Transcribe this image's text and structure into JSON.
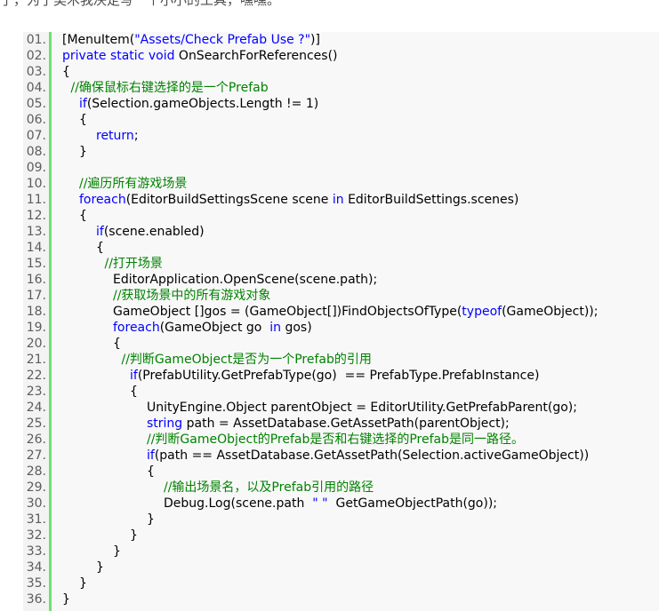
{
  "intro_text": "了，为了美术我决定写一个小小的工具，嘿嘿。",
  "code": {
    "lines": [
      {
        "num": "01.",
        "indent": 0,
        "tokens": [
          {
            "t": "[MenuItem(",
            "c": "plain"
          },
          {
            "t": "\"Assets/Check Prefab Use ?\"",
            "c": "string"
          },
          {
            "t": ")]",
            "c": "plain"
          }
        ]
      },
      {
        "num": "02.",
        "indent": 0,
        "tokens": [
          {
            "t": "private static void",
            "c": "keyword"
          },
          {
            "t": " OnSearchForReferences()",
            "c": "plain"
          }
        ]
      },
      {
        "num": "03.",
        "indent": 0,
        "tokens": [
          {
            "t": "{",
            "c": "plain"
          }
        ]
      },
      {
        "num": "04.",
        "indent": 1,
        "tokens": [
          {
            "t": "//确保鼠标右键选择的是一个Prefab",
            "c": "comment"
          }
        ]
      },
      {
        "num": "05.",
        "indent": 2,
        "tokens": [
          {
            "t": "if",
            "c": "keyword"
          },
          {
            "t": "(Selection.gameObjects.Length != 1)",
            "c": "plain"
          }
        ]
      },
      {
        "num": "06.",
        "indent": 2,
        "tokens": [
          {
            "t": "{",
            "c": "plain"
          }
        ]
      },
      {
        "num": "07.",
        "indent": 4,
        "tokens": [
          {
            "t": "return",
            "c": "keyword"
          },
          {
            "t": ";",
            "c": "plain"
          }
        ]
      },
      {
        "num": "08.",
        "indent": 2,
        "tokens": [
          {
            "t": "}",
            "c": "plain"
          }
        ]
      },
      {
        "num": "09.",
        "indent": 0,
        "tokens": []
      },
      {
        "num": "10.",
        "indent": 2,
        "tokens": [
          {
            "t": "//遍历所有游戏场景",
            "c": "comment"
          }
        ]
      },
      {
        "num": "11.",
        "indent": 2,
        "tokens": [
          {
            "t": "foreach",
            "c": "keyword"
          },
          {
            "t": "(EditorBuildSettingsScene scene ",
            "c": "plain"
          },
          {
            "t": "in",
            "c": "keyword"
          },
          {
            "t": " EditorBuildSettings.scenes)",
            "c": "plain"
          }
        ]
      },
      {
        "num": "12.",
        "indent": 2,
        "tokens": [
          {
            "t": "{",
            "c": "plain"
          }
        ]
      },
      {
        "num": "13.",
        "indent": 4,
        "tokens": [
          {
            "t": "if",
            "c": "keyword"
          },
          {
            "t": "(scene.enabled)",
            "c": "plain"
          }
        ]
      },
      {
        "num": "14.",
        "indent": 4,
        "tokens": [
          {
            "t": "{",
            "c": "plain"
          }
        ]
      },
      {
        "num": "15.",
        "indent": 5,
        "tokens": [
          {
            "t": "//打开场景",
            "c": "comment"
          }
        ]
      },
      {
        "num": "16.",
        "indent": 6,
        "tokens": [
          {
            "t": "EditorApplication.OpenScene(scene.path);",
            "c": "plain"
          }
        ]
      },
      {
        "num": "17.",
        "indent": 6,
        "tokens": [
          {
            "t": "//获取场景中的所有游戏对象",
            "c": "comment"
          }
        ]
      },
      {
        "num": "18.",
        "indent": 6,
        "tokens": [
          {
            "t": "GameObject []gos = (GameObject[])FindObjectsOfType(",
            "c": "plain"
          },
          {
            "t": "typeof",
            "c": "keyword"
          },
          {
            "t": "(GameObject));",
            "c": "plain"
          }
        ]
      },
      {
        "num": "19.",
        "indent": 6,
        "tokens": [
          {
            "t": "foreach",
            "c": "keyword"
          },
          {
            "t": "(GameObject go  ",
            "c": "plain"
          },
          {
            "t": "in",
            "c": "keyword"
          },
          {
            "t": " gos)",
            "c": "plain"
          }
        ]
      },
      {
        "num": "20.",
        "indent": 6,
        "tokens": [
          {
            "t": "{",
            "c": "plain"
          }
        ]
      },
      {
        "num": "21.",
        "indent": 7,
        "tokens": [
          {
            "t": "//判断GameObject是否为一个Prefab的引用",
            "c": "comment"
          }
        ]
      },
      {
        "num": "22.",
        "indent": 8,
        "tokens": [
          {
            "t": "if",
            "c": "keyword"
          },
          {
            "t": "(PrefabUtility.GetPrefabType(go)  == PrefabType.PrefabInstance)",
            "c": "plain"
          }
        ]
      },
      {
        "num": "23.",
        "indent": 8,
        "tokens": [
          {
            "t": "{",
            "c": "plain"
          }
        ]
      },
      {
        "num": "24.",
        "indent": 10,
        "tokens": [
          {
            "t": "UnityEngine.Object parentObject = EditorUtility.GetPrefabParent(go);",
            "c": "plain"
          }
        ]
      },
      {
        "num": "25.",
        "indent": 10,
        "tokens": [
          {
            "t": "string",
            "c": "keyword"
          },
          {
            "t": " path = AssetDatabase.GetAssetPath(parentObject);",
            "c": "plain"
          }
        ]
      },
      {
        "num": "26.",
        "indent": 10,
        "tokens": [
          {
            "t": "//判断GameObject的Prefab是否和右键选择的Prefab是同一路径。",
            "c": "comment"
          }
        ]
      },
      {
        "num": "27.",
        "indent": 10,
        "tokens": [
          {
            "t": "if",
            "c": "keyword"
          },
          {
            "t": "(path == AssetDatabase.GetAssetPath(Selection.activeGameObject))",
            "c": "plain"
          }
        ]
      },
      {
        "num": "28.",
        "indent": 10,
        "tokens": [
          {
            "t": "{",
            "c": "plain"
          }
        ]
      },
      {
        "num": "29.",
        "indent": 12,
        "tokens": [
          {
            "t": "//输出场景名，以及Prefab引用的路径",
            "c": "comment"
          }
        ]
      },
      {
        "num": "30.",
        "indent": 12,
        "tokens": [
          {
            "t": "Debug.Log(scene.path  ",
            "c": "plain"
          },
          {
            "t": "\" \"",
            "c": "string"
          },
          {
            "t": "  GetGameObjectPath(go));",
            "c": "plain"
          }
        ]
      },
      {
        "num": "31.",
        "indent": 10,
        "tokens": [
          {
            "t": "}",
            "c": "plain"
          }
        ]
      },
      {
        "num": "32.",
        "indent": 8,
        "tokens": [
          {
            "t": "}",
            "c": "plain"
          }
        ]
      },
      {
        "num": "33.",
        "indent": 6,
        "tokens": [
          {
            "t": "}",
            "c": "plain"
          }
        ]
      },
      {
        "num": "34.",
        "indent": 4,
        "tokens": [
          {
            "t": "}",
            "c": "plain"
          }
        ]
      },
      {
        "num": "35.",
        "indent": 2,
        "tokens": [
          {
            "t": "}",
            "c": "plain"
          }
        ]
      },
      {
        "num": "36.",
        "indent": 0,
        "tokens": [
          {
            "t": "}",
            "c": "plain"
          }
        ]
      }
    ]
  },
  "colors": {
    "keyword": "#0000ff",
    "comment": "#008200",
    "plain": "#000000",
    "string": "#0000ff",
    "gutter_bar": "#6ce26c",
    "line_number": "#5c5c5c"
  }
}
